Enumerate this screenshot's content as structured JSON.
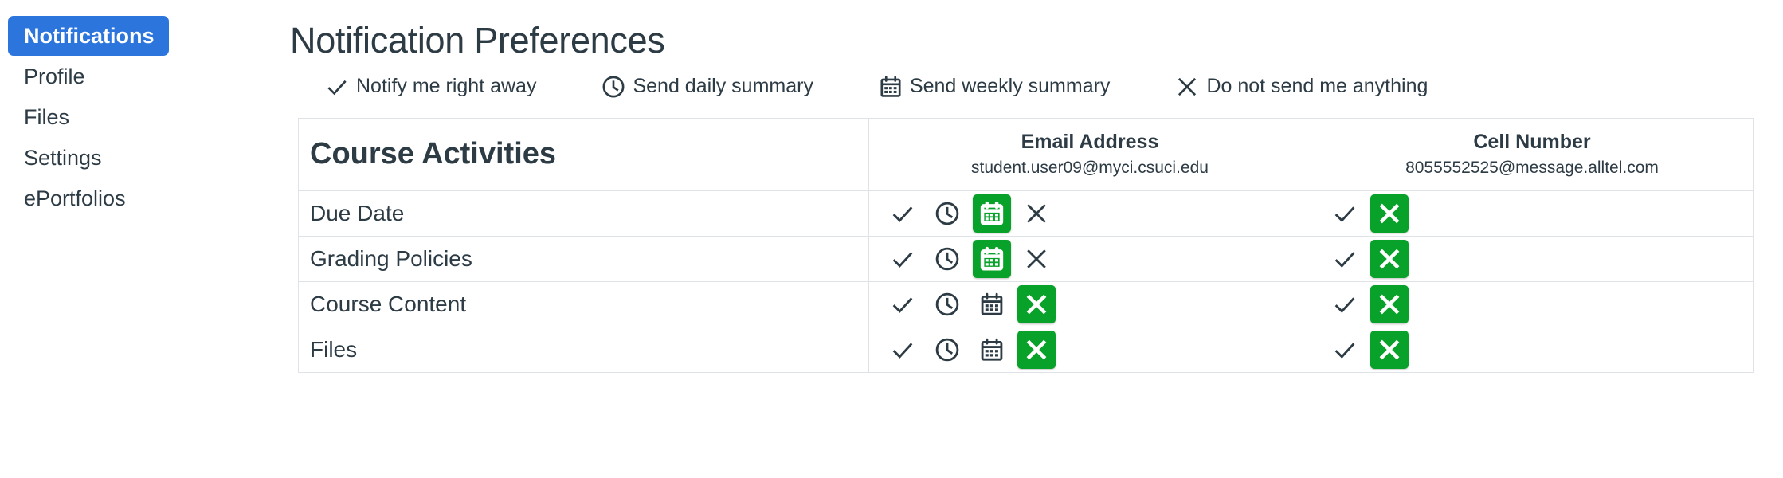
{
  "sidebar": {
    "items": [
      {
        "label": "Notifications",
        "active": true
      },
      {
        "label": "Profile",
        "active": false
      },
      {
        "label": "Files",
        "active": false
      },
      {
        "label": "Settings",
        "active": false
      },
      {
        "label": "ePortfolios",
        "active": false
      }
    ]
  },
  "header": {
    "title": "Notification Preferences"
  },
  "legend": {
    "items": [
      {
        "icon": "check-icon",
        "label": "Notify me right away"
      },
      {
        "icon": "clock-icon",
        "label": "Send daily summary"
      },
      {
        "icon": "calendar-icon",
        "label": "Send weekly summary"
      },
      {
        "icon": "x-icon",
        "label": "Do not send me anything"
      }
    ]
  },
  "table": {
    "category_title": "Course Activities",
    "channels": [
      {
        "name": "Email Address",
        "address": "student.user09@myci.csuci.edu"
      },
      {
        "name": "Cell Number",
        "address": "8055552525@message.alltel.com"
      }
    ],
    "colors": {
      "selected": "#08a12a",
      "accent": "#2c75dd",
      "text": "#2d3b45"
    },
    "rows": [
      {
        "label": "Due Date",
        "cells": [
          {
            "options": [
              "check-icon",
              "clock-icon",
              "calendar-icon",
              "x-icon"
            ],
            "selected": "calendar-icon"
          },
          {
            "options": [
              "check-icon",
              "x-icon"
            ],
            "selected": "x-icon"
          }
        ]
      },
      {
        "label": "Grading Policies",
        "cells": [
          {
            "options": [
              "check-icon",
              "clock-icon",
              "calendar-icon",
              "x-icon"
            ],
            "selected": "calendar-icon"
          },
          {
            "options": [
              "check-icon",
              "x-icon"
            ],
            "selected": "x-icon"
          }
        ]
      },
      {
        "label": "Course Content",
        "cells": [
          {
            "options": [
              "check-icon",
              "clock-icon",
              "calendar-icon",
              "x-icon"
            ],
            "selected": "x-icon"
          },
          {
            "options": [
              "check-icon",
              "x-icon"
            ],
            "selected": "x-icon"
          }
        ]
      },
      {
        "label": "Files",
        "cells": [
          {
            "options": [
              "check-icon",
              "clock-icon",
              "calendar-icon",
              "x-icon"
            ],
            "selected": "x-icon"
          },
          {
            "options": [
              "check-icon",
              "x-icon"
            ],
            "selected": "x-icon"
          }
        ]
      }
    ]
  }
}
